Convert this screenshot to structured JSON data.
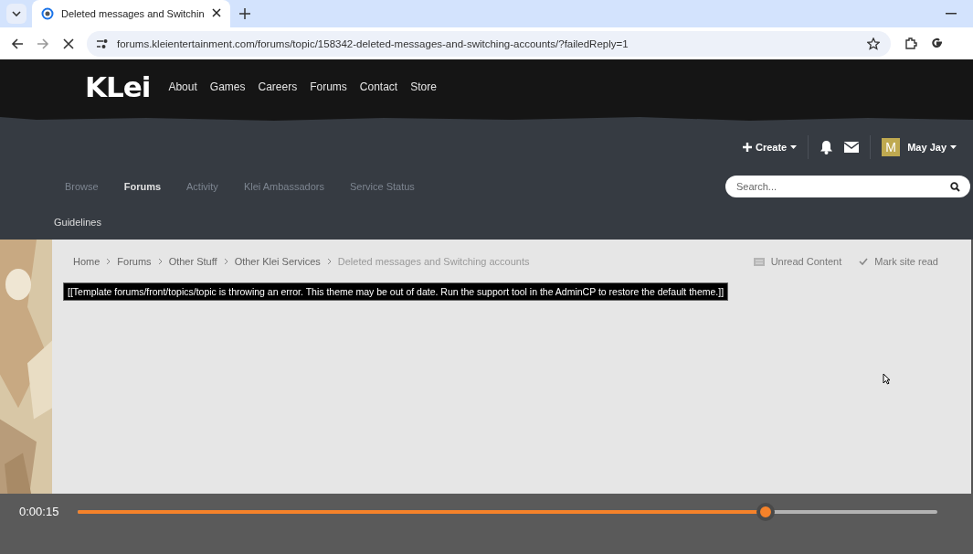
{
  "browser": {
    "tab": {
      "title": "Deleted messages and Switchin",
      "selected": true
    },
    "url": "forums.kleientertainment.com/forums/topic/158342-deleted-messages-and-switching-accounts/?failedReply=1"
  },
  "site": {
    "logo": "KLei",
    "nav": [
      "About",
      "Games",
      "Careers",
      "Forums",
      "Contact",
      "Store"
    ],
    "create": "Create",
    "user": {
      "initial": "M",
      "name": "May Jay"
    },
    "subnav": [
      {
        "label": "Browse",
        "selected": false
      },
      {
        "label": "Forums",
        "selected": true
      },
      {
        "label": "Activity",
        "selected": false
      },
      {
        "label": "Klei Ambassadors",
        "selected": false
      },
      {
        "label": "Service Status",
        "selected": false
      },
      {
        "label": "Guidelines",
        "selected": false
      }
    ],
    "search": {
      "placeholder": "Search..."
    }
  },
  "breadcrumbs": [
    "Home",
    "Forums",
    "Other Stuff",
    "Other Klei Services",
    "Deleted messages and Switching accounts"
  ],
  "actions": [
    "Unread Content",
    "Mark site read"
  ],
  "error": "[[Template forums/front/topics/topic is throwing an error. This theme may be out of date. Run the support tool in the AdminCP to restore the default theme.]]",
  "player": {
    "time": "0:00:15",
    "level": 0.8
  }
}
